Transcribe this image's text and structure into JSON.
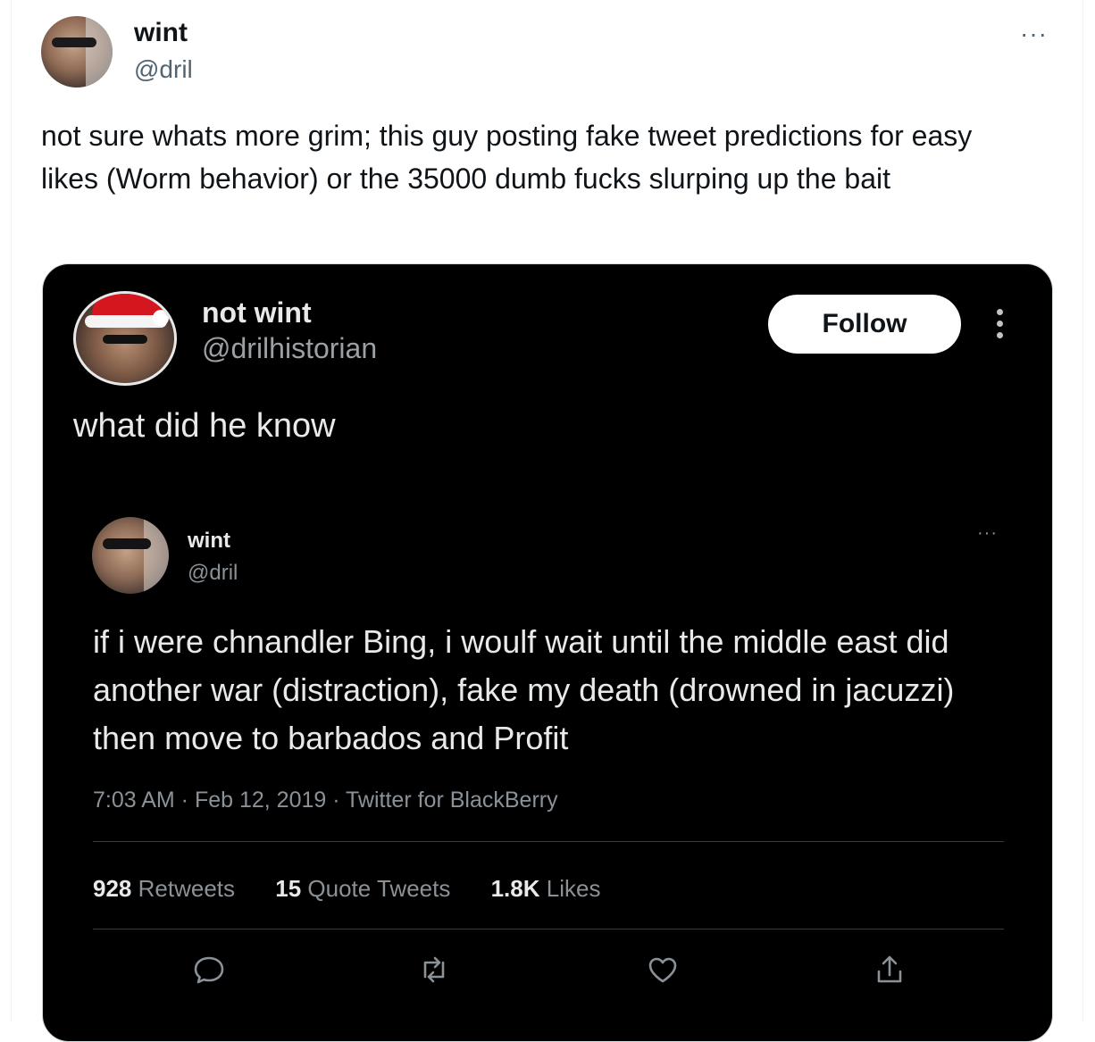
{
  "tweet": {
    "author_name": "wint",
    "author_handle": "@dril",
    "more": "···",
    "text": "not sure whats more grim; this guy posting fake tweet predictions for easy likes (Worm behavior) or the 35000 dumb fucks slurping up the bait"
  },
  "embedded": {
    "author_name": "not wint",
    "author_handle": "@drilhistorian",
    "follow_label": "Follow",
    "text": "what did he know",
    "quoted": {
      "author_name": "wint",
      "author_handle": "@dril",
      "more": "···",
      "text": "if i were chnandler Bing, i woulf wait until the middle east did another war (distraction), fake my death (drowned in jacuzzi) then move to barbados and Profit",
      "meta": "7:03 AM · Feb 12, 2019 · Twitter for BlackBerry",
      "stats": {
        "retweets_count": "928",
        "retweets_label": "Retweets",
        "quotes_count": "15",
        "quotes_label": "Quote Tweets",
        "likes_count": "1.8K",
        "likes_label": "Likes"
      }
    }
  }
}
